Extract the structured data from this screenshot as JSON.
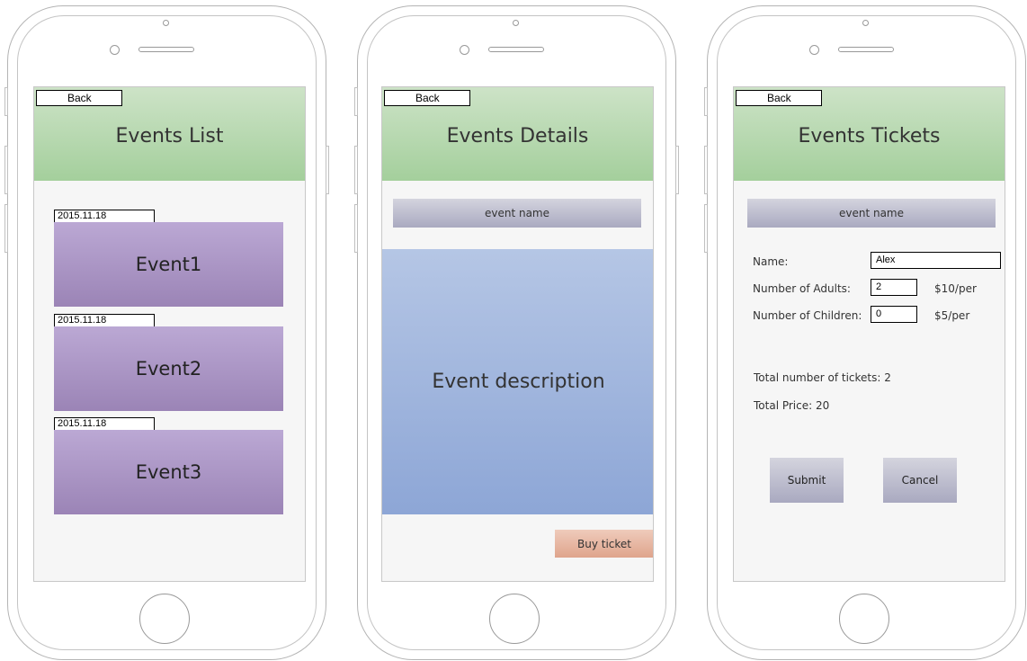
{
  "screens": [
    {
      "title": "Events List",
      "back_label": "Back",
      "events": [
        {
          "date": "2015.11.18",
          "name": "Event1"
        },
        {
          "date": "2015.11.18",
          "name": "Event2"
        },
        {
          "date": "2015.11.18",
          "name": "Event3"
        }
      ]
    },
    {
      "title": "Events Details",
      "back_label": "Back",
      "event_name": "event name",
      "description": "Event description",
      "buy_label": "Buy ticket"
    },
    {
      "title": "Events Tickets",
      "back_label": "Back",
      "event_name": "event name",
      "name_label": "Name:",
      "name_value": "Alex",
      "adults_label": "Number of Adults:",
      "adults_value": "2",
      "adults_price": "$10/per",
      "children_label": "Number of Children:",
      "children_value": "0",
      "children_price": "$5/per",
      "total_tickets": "Total number of tickets: 2",
      "total_price": "Total Price: 20",
      "submit_label": "Submit",
      "cancel_label": "Cancel"
    }
  ],
  "colors": {
    "header_top": "#cde3c7",
    "header_bottom": "#a4cf9c",
    "event_card": "#aa96c6",
    "name_bar": "#b8b8cc",
    "description": "#a0b4dd",
    "buy_button": "#e6b4a0"
  }
}
